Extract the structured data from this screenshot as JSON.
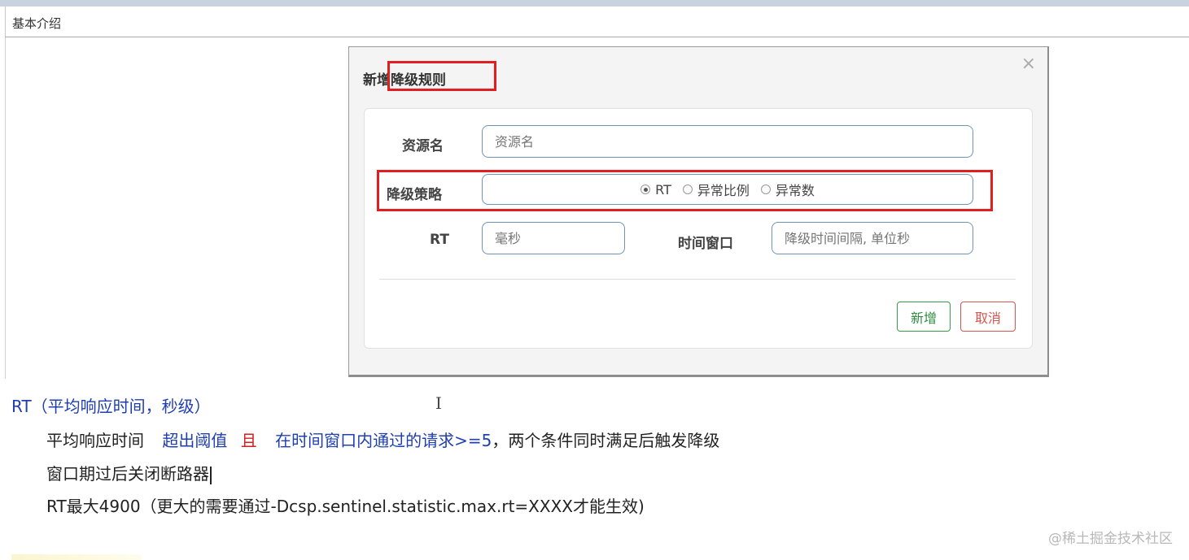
{
  "header": {
    "title": "基本介绍"
  },
  "modal": {
    "title": "新增降级规则",
    "close_icon": "×",
    "resource": {
      "label": "资源名",
      "placeholder": "资源名"
    },
    "strategy": {
      "label": "降级策略",
      "options": [
        "RT",
        "异常比例",
        "异常数"
      ],
      "selected": "RT"
    },
    "rt": {
      "label": "RT",
      "placeholder": "毫秒"
    },
    "window": {
      "label": "时间窗口",
      "placeholder": "降级时间间隔, 单位秒"
    },
    "buttons": {
      "add": "新增",
      "cancel": "取消"
    },
    "highlight_color": "#e02020"
  },
  "notes": {
    "heading": "RT（平均响应时间，秒级）",
    "line1": {
      "p1": "平均响应时间",
      "p2": "超出阈值",
      "p3": "且",
      "p4": "在时间窗口内通过的请求>=5",
      "p5": "，两个条件同时满足后触发降级"
    },
    "line2": "窗口期过后关闭断路器",
    "line3": "RT最大4900（更大的需要通过-Dcsp.sentinel.statistic.max.rt=XXXX才能生效)"
  },
  "watermark": "@稀土掘金技术社区"
}
